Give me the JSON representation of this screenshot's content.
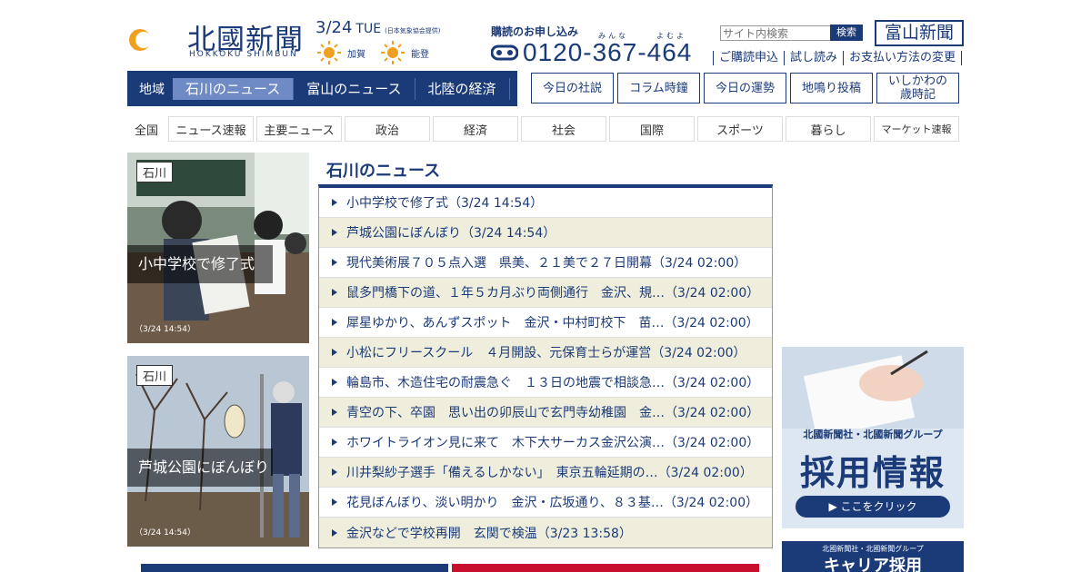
{
  "header": {
    "logo_name": "北國新聞",
    "logo_roman": "HOKKOKU SHIMBUN",
    "date": "3/24",
    "weekday": "TUE",
    "weather_source": "(日本気象協会提供)",
    "weather": [
      {
        "area": "加賀"
      },
      {
        "area": "能登"
      }
    ],
    "subscribe_title": "購読のお申し込み",
    "phone_ruby": [
      "みんな",
      "よむよ"
    ],
    "phone": "0120-367-464",
    "search_placeholder": "サイト内検索",
    "search_button": "検索",
    "toyama_button": "富山新聞",
    "sublinks": [
      "ご購読申込",
      "試し読み",
      "お支払い方法の変更"
    ]
  },
  "region_nav": {
    "label": "地域",
    "tabs": [
      "石川のニュース",
      "富山のニュース",
      "北陸の経済"
    ]
  },
  "column_links": [
    "今日の社説",
    "コラム時鐘",
    "今日の運勢",
    "地鳴り投稿",
    "いしかわの歳時記"
  ],
  "genre_tabs": [
    "全国",
    "ニュース速報",
    "主要ニュース",
    "政治",
    "経済",
    "社会",
    "国際",
    "スポーツ",
    "暮らし",
    "マーケット速報"
  ],
  "photos": [
    {
      "tag": "石川",
      "caption": "小中学校で修了式",
      "time": "（3/24 14:54）"
    },
    {
      "tag": "石川",
      "caption": "芦城公園にぼんぼり",
      "time": "（3/24 14:54）"
    }
  ],
  "news": {
    "title": "石川のニュース",
    "items": [
      "小中学校で修了式（3/24 14:54）",
      "芦城公園にぼんぼり（3/24 14:54）",
      "現代美術展７０５点入選　県美、２１美で２７日開幕（3/24 02:00）",
      "鼠多門橋下の道、１年５カ月ぶり両側通行　金沢、規…（3/24 02:00）",
      "犀星ゆかり、あんずスポット　金沢・中村町校下　苗…（3/24 02:00）",
      "小松にフリースクール　４月開設、元保育士らが運営（3/24 02:00）",
      "輪島市、木造住宅の耐震急ぐ　１３日の地震で相談急…（3/24 02:00）",
      "青空の下、卒園　思い出の卯辰山で玄門寺幼稚園　金…（3/24 02:00）",
      "ホワイトライオン見に来て　木下大サーカス金沢公演…（3/24 02:00）",
      "川井梨紗子選手「備えるしかない」　東京五輪延期の…（3/24 02:00）",
      "花見ぼんぼり、淡い明かり　金沢・広坂通り、８３基…（3/24 02:00）",
      "金沢などで学校再開　玄関で検温（3/23 13:58）"
    ]
  },
  "banners": {
    "recruit_group": "北國新聞社・北國新聞グループ",
    "recruit_title": "採用情報",
    "recruit_button": "▶ ここをクリック",
    "career_group": "北國新聞社・北國新聞グループ",
    "career_title": "キャリア採用"
  },
  "colors": {
    "brand": "#1b3a78",
    "row_alt": "#efeedd"
  }
}
